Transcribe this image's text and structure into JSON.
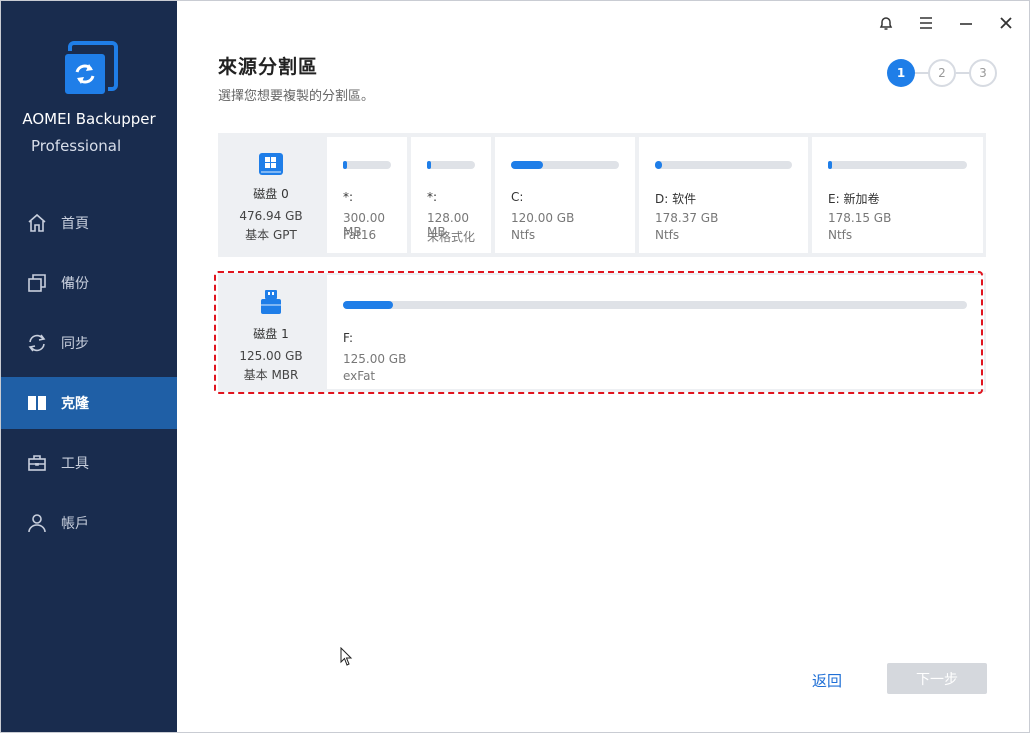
{
  "app": {
    "name": "AOMEI Backupper",
    "edition": "Professional"
  },
  "nav": [
    {
      "label": "首頁",
      "icon": "home-icon",
      "active": false
    },
    {
      "label": "備份",
      "icon": "backup-icon",
      "active": false
    },
    {
      "label": "同步",
      "icon": "sync-icon",
      "active": false
    },
    {
      "label": "克隆",
      "icon": "clone-icon",
      "active": true
    },
    {
      "label": "工具",
      "icon": "toolbox-icon",
      "active": false
    },
    {
      "label": "帳戶",
      "icon": "user-icon",
      "active": false
    }
  ],
  "page": {
    "title": "來源分割區",
    "subtitle": "選擇您想要複製的分割區。"
  },
  "steps": [
    "1",
    "2",
    "3"
  ],
  "disks": [
    {
      "name": "磁盘 0",
      "size": "476.94 GB",
      "type": "基本 GPT",
      "icon": "windows-disk-icon",
      "partitions": [
        {
          "name": "*:",
          "size": "300.00 MB",
          "fs": "Fat16",
          "used": 0.05
        },
        {
          "name": "*:",
          "size": "128.00 MB",
          "fs": "未格式化",
          "used": 0.05
        },
        {
          "name": "C:",
          "size": "120.00 GB",
          "fs": "Ntfs",
          "used": 0.3
        },
        {
          "name": "D: 软件",
          "size": "178.37 GB",
          "fs": "Ntfs",
          "used": 0.05
        },
        {
          "name": "E: 新加卷",
          "size": "178.15 GB",
          "fs": "Ntfs",
          "used": 0.03
        }
      ]
    },
    {
      "name": "磁盘 1",
      "size": "125.00 GB",
      "type": "基本 MBR",
      "icon": "usb-drive-icon",
      "partitions": [
        {
          "name": "F:",
          "size": "125.00 GB",
          "fs": "exFat",
          "used": 0.08
        }
      ]
    }
  ],
  "footer": {
    "back": "返回",
    "next": "下一步"
  },
  "colors": {
    "sidebar": "#192c4e",
    "active_nav": "#1f5fa6",
    "accent": "#1f7ee8",
    "selection": "#e0141e"
  }
}
